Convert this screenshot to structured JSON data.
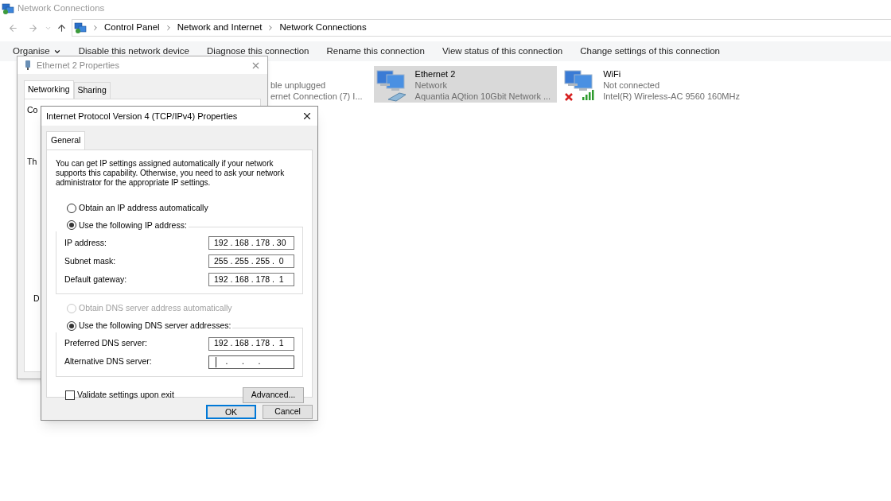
{
  "window": {
    "title": "Network Connections"
  },
  "breadcrumb": [
    "Control Panel",
    "Network and Internet",
    "Network Connections"
  ],
  "toolbar": [
    {
      "label": "Organise",
      "menu": true
    },
    {
      "label": "Disable this network device",
      "menu": false
    },
    {
      "label": "Diagnose this connection",
      "menu": false
    },
    {
      "label": "Rename this connection",
      "menu": false
    },
    {
      "label": "View status of this connection",
      "menu": false
    },
    {
      "label": "Change settings of this connection",
      "menu": false
    }
  ],
  "connections": [
    {
      "status": "ble unplugged",
      "adapter": "ernet Connection (7) I...",
      "selected": false
    },
    {
      "kind": "wired",
      "name": "Ethernet 2",
      "status": "Network",
      "adapter": "Aquantia AQtion 10Gbit Network ...",
      "selected": true,
      "connected": true
    },
    {
      "kind": "wireless",
      "name": "WiFi",
      "status": "Not connected",
      "adapter": "Intel(R) Wireless-AC 9560 160MHz",
      "selected": false,
      "connected": false
    }
  ],
  "properties_dialog": {
    "title": "Ethernet 2 Properties",
    "tabs": [
      {
        "label": "Networking",
        "selected": true
      },
      {
        "label": "Sharing",
        "selected": false
      }
    ],
    "fragments": [
      "Co",
      "Th",
      "D"
    ]
  },
  "ipv4_dialog": {
    "title": "Internet Protocol Version 4 (TCP/IPv4) Properties",
    "tabs": [
      {
        "label": "General",
        "selected": true
      }
    ],
    "description": "You can get IP settings assigned automatically if your network supports this capability. Otherwise, you need to ask your network administrator for the appropriate IP settings.",
    "ip_auto": {
      "label": "Obtain an IP address automatically",
      "selected": false,
      "disabled": false
    },
    "ip_manual": {
      "label": "Use the following IP address:",
      "selected": true,
      "disabled": false
    },
    "ip_fields": [
      {
        "label": "IP address:",
        "value": "192 . 168 . 178 . 30"
      },
      {
        "label": "Subnet mask:",
        "value": "255 . 255 . 255 .  0"
      },
      {
        "label": "Default gateway:",
        "value": "192 . 168 . 178 .  1"
      }
    ],
    "dns_auto": {
      "label": "Obtain DNS server address automatically",
      "selected": false,
      "disabled": true
    },
    "dns_manual": {
      "label": "Use the following DNS server addresses:",
      "selected": true,
      "disabled": false
    },
    "dns_fields": [
      {
        "label": "Preferred DNS server:",
        "value": "192 . 168 . 178 .  1",
        "focused": false
      },
      {
        "label": "Alternative DNS server:",
        "value": "     .      .      .",
        "focused": true
      }
    ],
    "validate": {
      "label": "Validate settings upon exit",
      "checked": false
    },
    "advanced": "Advanced...",
    "ok": {
      "label": "OK",
      "default": true
    },
    "cancel": {
      "label": "Cancel",
      "default": false
    }
  }
}
